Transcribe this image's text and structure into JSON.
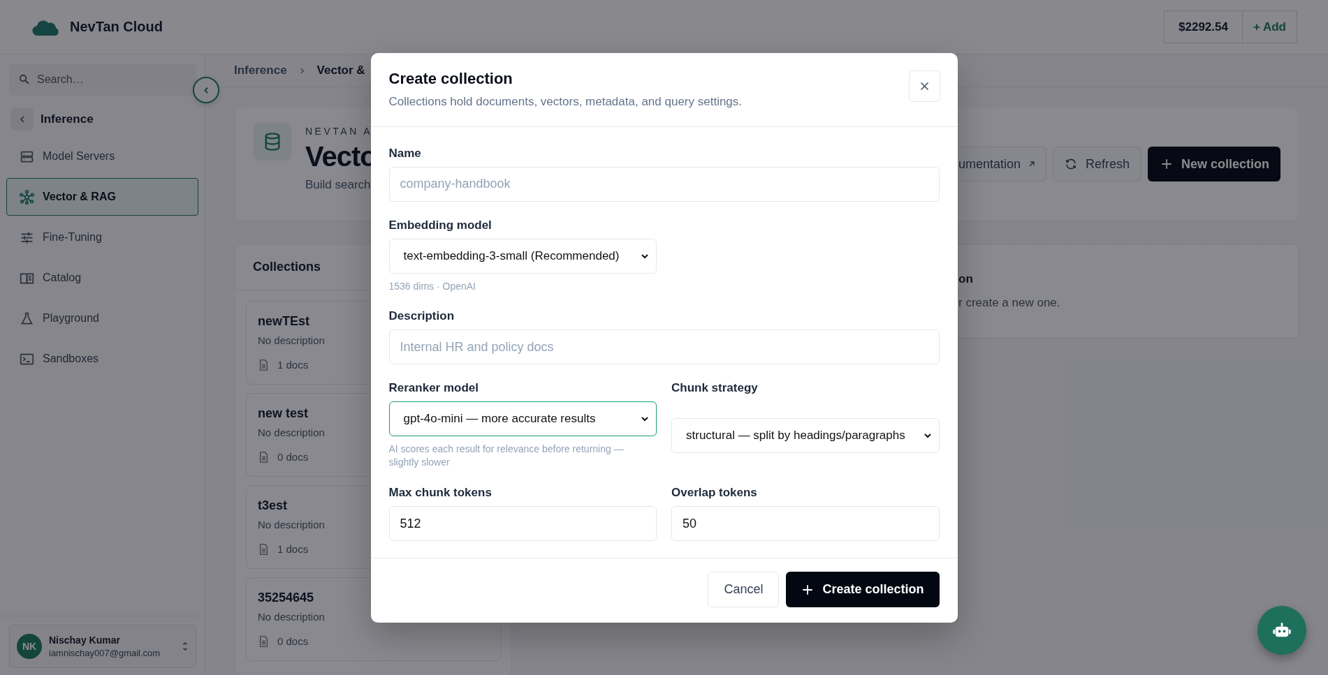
{
  "header": {
    "brand": "NevTan Cloud",
    "balance": "$2292.54",
    "add_label": "+ Add"
  },
  "sidebar": {
    "search": {
      "placeholder": "Search…"
    },
    "section": "Inference",
    "items": [
      {
        "label": "Model Servers",
        "selected": false
      },
      {
        "label": "Vector & RAG",
        "selected": true
      },
      {
        "label": "Fine-Tuning",
        "selected": false
      },
      {
        "label": "Catalog",
        "selected": false
      },
      {
        "label": "Playground",
        "selected": false
      },
      {
        "label": "Sandboxes",
        "selected": false
      }
    ],
    "user": {
      "initials": "NK",
      "name": "Nischay Kumar",
      "email": "iamnischay007@gmail.com"
    }
  },
  "breadcrumb": [
    "Inference",
    "Vector &"
  ],
  "page_header": {
    "eyebrow": "NEVTAN A",
    "title": "Vecto",
    "subtitle": "Build search",
    "buttons": [
      {
        "label": "umentation",
        "kind": "external"
      },
      {
        "label": "Refresh",
        "kind": "refresh"
      },
      {
        "label": "New collection",
        "kind": "primary"
      }
    ]
  },
  "collections": {
    "title": "Collections",
    "items": [
      {
        "name": "newTEst",
        "description": "No description",
        "docs": "1 docs"
      },
      {
        "name": "new test",
        "description": "No description",
        "docs": "0 docs"
      },
      {
        "name": "t3est",
        "description": "No description",
        "docs": "1 docs"
      },
      {
        "name": "35254645",
        "description": "No description",
        "docs": "0 docs"
      }
    ]
  },
  "empty_state": {
    "title": "on",
    "text": "r create a new one."
  },
  "modal": {
    "title": "Create collection",
    "subtitle": "Collections hold documents, vectors, metadata, and query settings.",
    "fields": [
      {
        "kind": "text",
        "label": "Name",
        "placeholder": "company-handbook"
      },
      {
        "kind": "select",
        "label": "Embedding model",
        "value": "text-embedding-3-small (Recommended)",
        "hint": "1536 dims · OpenAI",
        "focused": false
      },
      {
        "kind": "text",
        "label": "Description",
        "placeholder": "Internal HR and policy docs"
      }
    ],
    "grid_fields": [
      {
        "kind": "select",
        "label": "Reranker model",
        "value": "gpt-4o-mini — more accurate results",
        "hint": "AI scores each result for relevance before returning — slightly slower",
        "focused": true
      },
      {
        "kind": "select",
        "label": "Chunk strategy",
        "value": "structural — split by headings/paragraphs",
        "focused": false
      },
      {
        "kind": "text",
        "label": "Max chunk tokens",
        "value": "512"
      },
      {
        "kind": "text",
        "label": "Overlap tokens",
        "value": "50"
      }
    ],
    "cancel": "Cancel",
    "submit": "Create collection"
  }
}
